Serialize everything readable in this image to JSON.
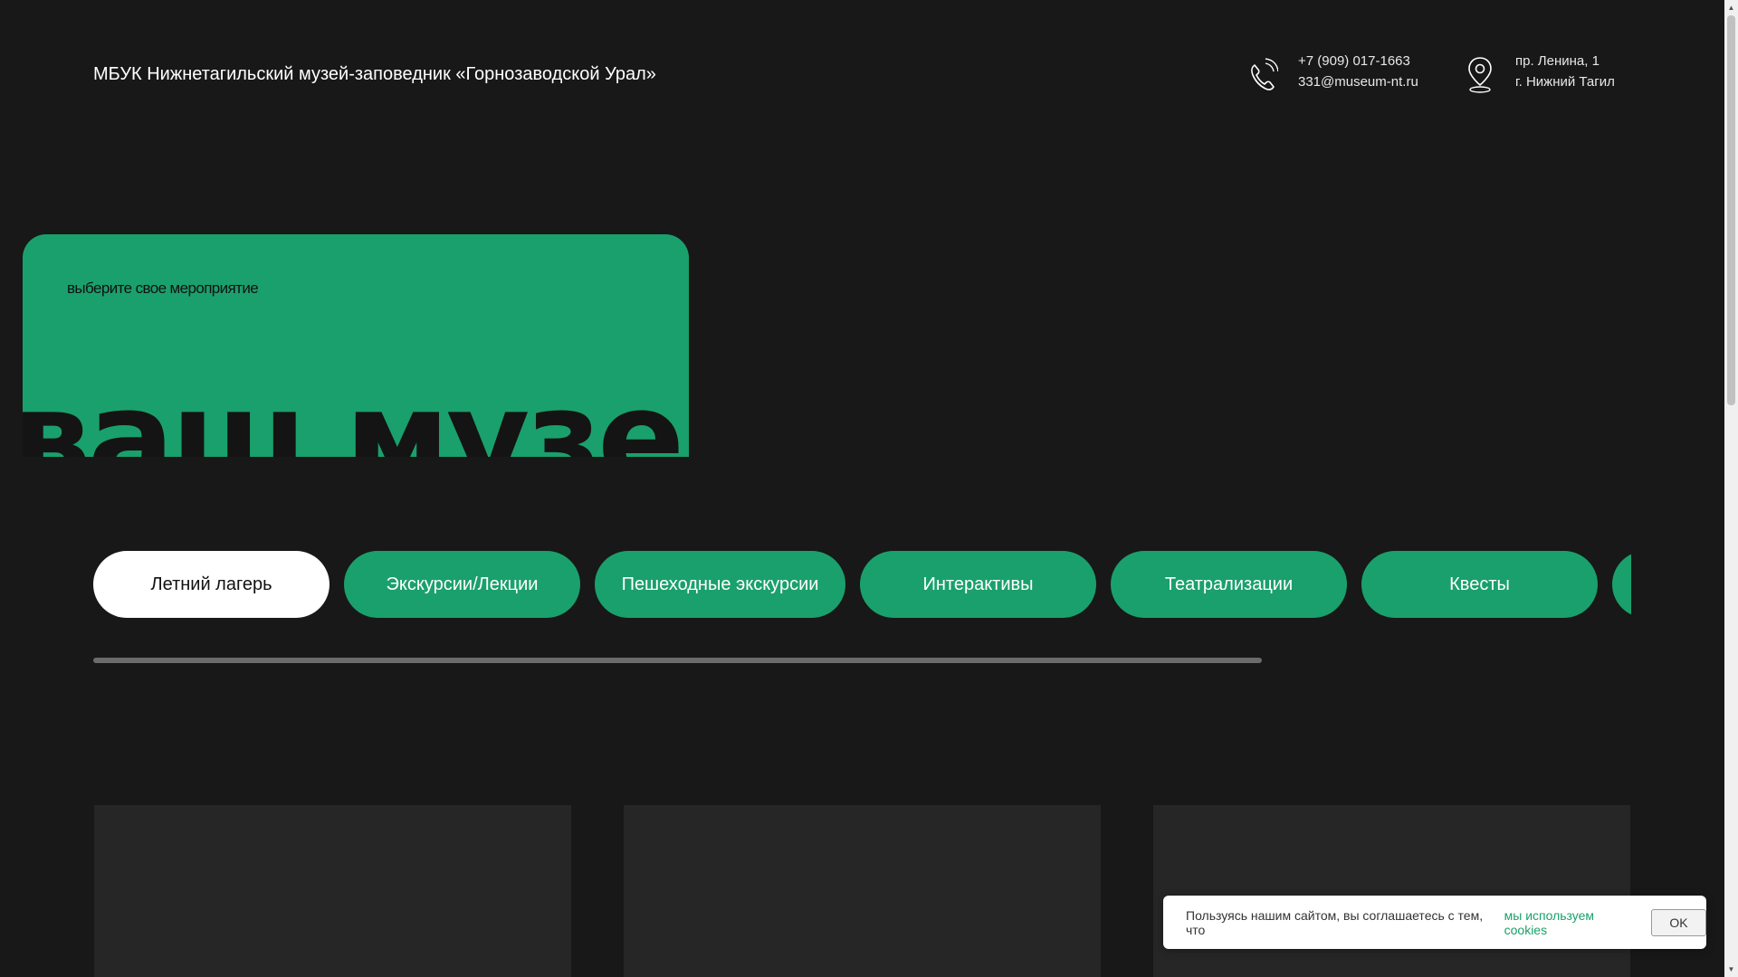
{
  "header": {
    "org_title": "МБУК Нижнетагильский музей-заповедник «Горнозаводской Урал»",
    "phone": "+7 (909) 017-1663",
    "email": "331@museum-nt.ru",
    "address_line1": "пр. Ленина, 1",
    "address_line2": "г. Нижний Тагил",
    "icons": {
      "phone": "phone-icon",
      "location": "location-pin-icon"
    }
  },
  "hero": {
    "subtitle": "выберите свое мероприятие",
    "big_text": "ваш музей"
  },
  "tabs": [
    {
      "label": "Летний лагерь",
      "active": true
    },
    {
      "label": "Экскурсии/Лекции",
      "active": false
    },
    {
      "label": "Пешеходные экскурсии",
      "active": false
    },
    {
      "label": "Интерактивы",
      "active": false
    },
    {
      "label": "Театрализации",
      "active": false
    },
    {
      "label": "Квесты",
      "active": false
    },
    {
      "label": "",
      "active": false
    }
  ],
  "tabs_scroll_progress": 0.76,
  "cookie": {
    "text": "Пользуясь нашим сайтом, вы соглашаетесь с тем, что",
    "link": "мы используем cookies",
    "ok": "OK"
  },
  "colors": {
    "background": "#181818",
    "accent": "#1aa06c",
    "card": "#262626"
  }
}
